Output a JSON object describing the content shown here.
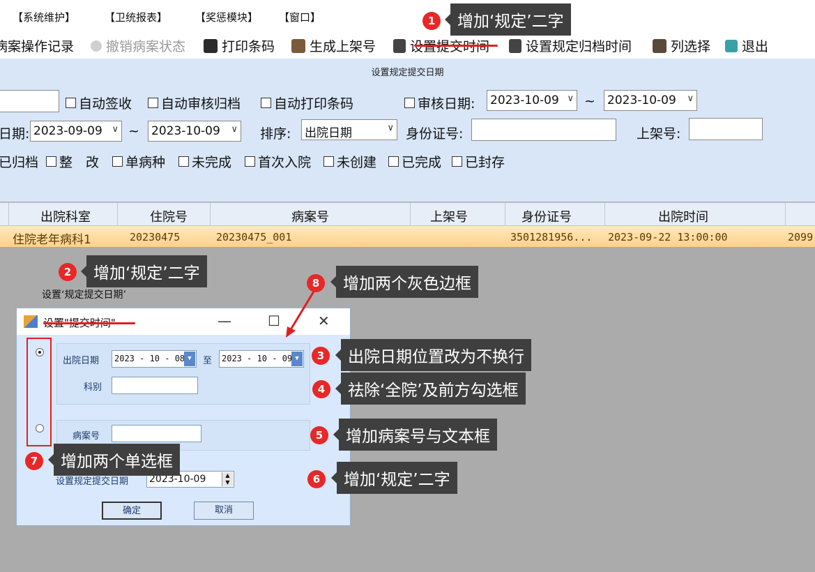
{
  "menu": [
    "【系统维护】",
    "【卫统报表】",
    "【奖惩模块】",
    "【窗口】"
  ],
  "toolbar": {
    "items": [
      {
        "label": "病案操作记录",
        "disabled": false
      },
      {
        "label": "撤销病案状态",
        "disabled": true
      },
      {
        "label": "打印条码",
        "disabled": false
      },
      {
        "label": "生成上架号",
        "disabled": false
      },
      {
        "label": "设置提交时间",
        "disabled": false
      },
      {
        "label": "设置规定归档时间",
        "disabled": false
      },
      {
        "label": "列选择",
        "disabled": false
      },
      {
        "label": "退出",
        "disabled": false
      }
    ]
  },
  "filter": {
    "title": "设置规定提交日期",
    "auto_sign": "自动签收",
    "auto_audit": "自动审核归档",
    "auto_print": "自动打印条码",
    "audit_date_label": "审核日期:",
    "audit_date_from": "2023-10-09",
    "audit_date_to": "2023-10-09",
    "tilde": "~",
    "discharge_date_label": "日期:",
    "discharge_from": "2023-09-09",
    "discharge_to": "2023-10-09",
    "sort_label": "排序:",
    "sort_value": "出院日期",
    "idcard_label": "身份证号:",
    "shelf_label": "上架号:",
    "status_checks": [
      "已归档",
      "整　改",
      "单病种",
      "未完成",
      "首次入院",
      "未创建",
      "已完成",
      "已封存"
    ]
  },
  "grid": {
    "headers": [
      "出院科室",
      "住院号",
      "病案号",
      "上架号",
      "身份证号",
      "出院时间"
    ],
    "row": {
      "dept": "住院老年病科1",
      "inpatient_no": "20230475",
      "case_no": "20230475_001",
      "shelf_no": "",
      "idcard": "3501281956...",
      "discharge_time": "2023-09-22 13:00:00",
      "extra": "2099"
    }
  },
  "annotations": {
    "c1": "增加‘规定’二字",
    "c2": "增加‘规定’二字",
    "c3": "出院日期位置改为不换行",
    "c4": "祛除‘全院’及前方勾选框",
    "c5": "增加病案号与文本框",
    "c6": "增加‘规定’二字",
    "c7": "增加两个单选框",
    "c8": "增加两个灰色边框",
    "n1": "1",
    "n2": "2",
    "n3": "3",
    "n4": "4",
    "n5": "5",
    "n6": "6",
    "n7": "7",
    "n8": "8"
  },
  "dialog_caption": "设置‘规定提交日期’",
  "dialog": {
    "title": "设置\"提交时间\"",
    "discharge_date_label": "出院日期",
    "date_from": "2023 - 10 - 08",
    "to_label": "至",
    "date_to": "2023 - 10 - 09",
    "dept_label": "科别",
    "case_no_label": "病案号",
    "set_date_label": "设置规定提交日期",
    "set_date_value": "2023-10-09",
    "ok": "确定",
    "cancel": "取消"
  },
  "colors": {
    "accent_red": "#e02020",
    "row_highlight": "#ffd18a",
    "panel_blue": "#d8e6f7"
  }
}
